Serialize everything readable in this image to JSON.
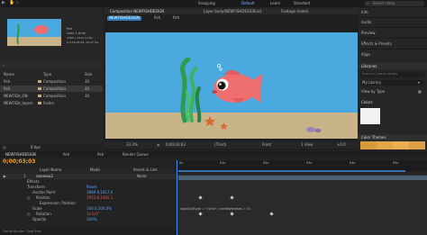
{
  "topbar": {
    "snapping": "Snapping",
    "workspaces": [
      "Default",
      "Learn",
      "Standard"
    ],
    "search_placeholder": "Search Help"
  },
  "project": {
    "item_name": "fish",
    "item_info": "used 1 time",
    "item_dims": "1380 x 1312 (1.00)",
    "item_duration": "Δ 0;00;05;29, 29.97 fps",
    "columns": {
      "name": "Name",
      "type": "Type",
      "size": "Size"
    },
    "rows": [
      {
        "name": "fish",
        "type": "Composition",
        "fps": "30",
        "color": "#c6b36b"
      },
      {
        "name": "fish",
        "type": "Composition",
        "fps": "30",
        "color": "#c6b36b"
      },
      {
        "name": "NEWFISH_ON",
        "type": "Composition",
        "fps": "30",
        "color": "#c6b36b"
      },
      {
        "name": "NEWFISH_layers",
        "type": "Folder",
        "fps": "",
        "color": "#c6b36b"
      }
    ],
    "bpc": "8 bpc"
  },
  "viewer": {
    "tab_comp": "Composition NEWFISHDESIGN",
    "tab_layer": "Layer body(NEWFISHDESIGN.ai)",
    "tab_footage": "Footage (none)",
    "crumbs": [
      "NEWFISHDESIGN",
      "fish",
      "fish"
    ],
    "zoom": "33.3%",
    "time": "0;00;03;03",
    "quality": "(Third)",
    "camera": "Front",
    "view": "1 View",
    "exposure": "+0.0"
  },
  "right_panel": {
    "items": [
      "Info",
      "Audio",
      "Preview",
      "Effects & Presets",
      "Align"
    ],
    "libraries_title": "Libraries",
    "lib_search_placeholder": "Search Current Library",
    "my_library": "My Library",
    "view_by": "View by Type",
    "colors_label": "Colors",
    "color_themes_label": "Color Themes"
  },
  "timeline": {
    "tabs": [
      "NEWFISHDESIGN",
      "fish",
      "fish",
      "Render Queue"
    ],
    "timecode": "0;00;03;03",
    "columns": {
      "layer_name": "Layer Name",
      "mode": "Mode",
      "parent": "Parent & Link"
    },
    "layers": [
      {
        "num": "1",
        "name": "rooneou2",
        "parent": "None"
      },
      {
        "prop": "Effects"
      },
      {
        "prop": "Transform",
        "value": "Reset"
      },
      {
        "prop": "Anchor Point",
        "value": "1869.8,1417.0"
      },
      {
        "prop": "Position",
        "value": "1953.6,1465.1"
      },
      {
        "prop": "Expression: Position",
        "value": ""
      },
      {
        "prop": "Scale",
        "value": "100.0,100.0%"
      },
      {
        "prop": "Rotation",
        "value": "1x-0.0°"
      },
      {
        "prop": "Opacity",
        "value": "100%"
      }
    ],
    "expression": "loopOut(type = \"cycle\", numKeyframes = 0)",
    "ruler_marks": [
      "0s",
      "01s",
      "02s",
      "03s",
      "04s",
      "05s"
    ],
    "render_label": "Frame Render Time 5ms"
  },
  "colors": {
    "water": "#4aa9df",
    "sand": "#c9b48a",
    "fish": "#ef6f6f",
    "accent": "#4b8df7",
    "timecode": "#f0a030",
    "color_theme_swatches": [
      "#d79b3f",
      "#e2a64a",
      "#eaae52",
      "#dda049"
    ]
  }
}
